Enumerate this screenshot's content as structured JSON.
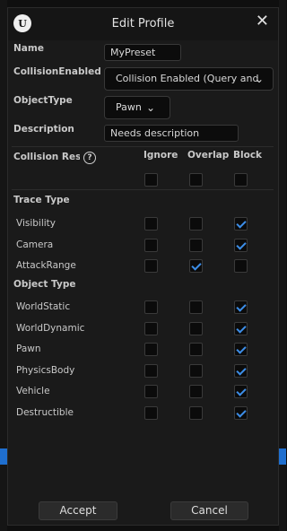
{
  "dialog": {
    "title": "Edit Profile",
    "logo_text": "U",
    "close_glyph": "✕"
  },
  "fields": {
    "name": {
      "label": "Name",
      "value": "MyPreset"
    },
    "collision_enabled": {
      "label": "CollisionEnabled",
      "value": "Collision Enabled (Query and"
    },
    "object_type": {
      "label": "ObjectType",
      "value": "Pawn"
    },
    "description": {
      "label": "Description",
      "value": "Needs description"
    }
  },
  "responses": {
    "header_label": "Collision Respo",
    "help_glyph": "?",
    "columns": [
      "Ignore",
      "Overlap",
      "Block"
    ],
    "trace_section": "Trace Type",
    "object_section": "Object Type",
    "trace_rows": [
      {
        "label": "Visibility",
        "checked": [
          false,
          false,
          true
        ]
      },
      {
        "label": "Camera",
        "checked": [
          false,
          false,
          true
        ]
      },
      {
        "label": "AttackRange",
        "checked": [
          false,
          true,
          false
        ]
      }
    ],
    "object_rows": [
      {
        "label": "WorldStatic",
        "checked": [
          false,
          false,
          true
        ]
      },
      {
        "label": "WorldDynamic",
        "checked": [
          false,
          false,
          true
        ]
      },
      {
        "label": "Pawn",
        "checked": [
          false,
          false,
          true
        ]
      },
      {
        "label": "PhysicsBody",
        "checked": [
          false,
          false,
          true
        ]
      },
      {
        "label": "Vehicle",
        "checked": [
          false,
          false,
          true
        ]
      },
      {
        "label": "Destructible",
        "checked": [
          false,
          false,
          true
        ]
      }
    ]
  },
  "buttons": {
    "accept": "Accept",
    "cancel": "Cancel"
  },
  "chevron_glyph": "⌄",
  "colors": {
    "accent": "#3d8ee8",
    "background": "#1a1a1a"
  }
}
